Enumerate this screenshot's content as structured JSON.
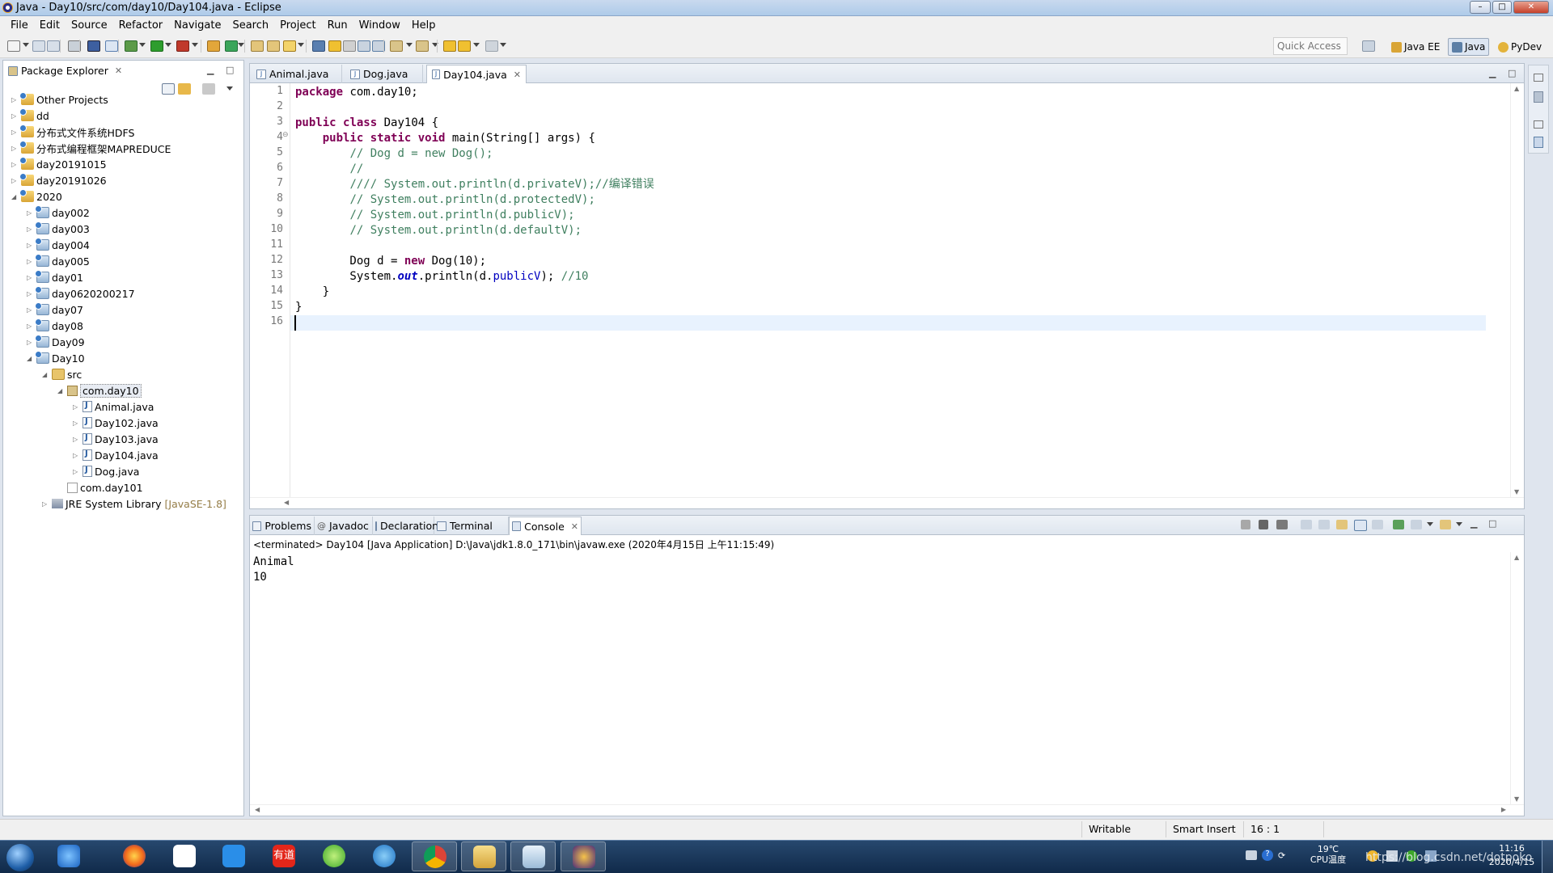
{
  "window": {
    "title": "Java - Day10/src/com/day10/Day104.java - Eclipse",
    "minimize": "–",
    "maximize": "□",
    "close": "✕"
  },
  "menu": [
    "File",
    "Edit",
    "Source",
    "Refactor",
    "Navigate",
    "Search",
    "Project",
    "Run",
    "Window",
    "Help"
  ],
  "toolbar": {
    "quick_access_placeholder": "Quick Access",
    "perspectives": [
      "Java EE",
      "Java",
      "PyDev"
    ],
    "active_perspective": "Java"
  },
  "package_explorer": {
    "title": "Package Explorer",
    "close": "✕",
    "items": [
      {
        "label": "Other Projects",
        "level": 0,
        "expanded": false,
        "icon": "working-set"
      },
      {
        "label": "dd",
        "level": 0,
        "expanded": false,
        "icon": "working-set"
      },
      {
        "label": "分布式文件系统HDFS",
        "level": 0,
        "expanded": false,
        "icon": "working-set"
      },
      {
        "label": "分布式编程框架MAPREDUCE",
        "level": 0,
        "expanded": false,
        "icon": "working-set"
      },
      {
        "label": "day20191015",
        "level": 0,
        "expanded": false,
        "icon": "working-set"
      },
      {
        "label": "day20191026",
        "level": 0,
        "expanded": false,
        "icon": "working-set"
      },
      {
        "label": "2020",
        "level": 0,
        "expanded": true,
        "icon": "working-set"
      },
      {
        "label": "day002",
        "level": 1,
        "expanded": false,
        "icon": "java-project"
      },
      {
        "label": "day003",
        "level": 1,
        "expanded": false,
        "icon": "java-project"
      },
      {
        "label": "day004",
        "level": 1,
        "expanded": false,
        "icon": "java-project"
      },
      {
        "label": "day005",
        "level": 1,
        "expanded": false,
        "icon": "java-project"
      },
      {
        "label": "day01",
        "level": 1,
        "expanded": false,
        "icon": "java-project"
      },
      {
        "label": "day0620200217",
        "level": 1,
        "expanded": false,
        "icon": "java-project"
      },
      {
        "label": "day07",
        "level": 1,
        "expanded": false,
        "icon": "java-project"
      },
      {
        "label": "day08",
        "level": 1,
        "expanded": false,
        "icon": "java-project"
      },
      {
        "label": "Day09",
        "level": 1,
        "expanded": false,
        "icon": "java-project"
      },
      {
        "label": "Day10",
        "level": 1,
        "expanded": true,
        "icon": "java-project"
      },
      {
        "label": "src",
        "level": 2,
        "expanded": true,
        "icon": "source-folder"
      },
      {
        "label": "com.day10",
        "level": 3,
        "expanded": true,
        "icon": "package",
        "selected": true
      },
      {
        "label": "Animal.java",
        "level": 4,
        "expanded": false,
        "icon": "java-file"
      },
      {
        "label": "Day102.java",
        "level": 4,
        "expanded": false,
        "icon": "java-file"
      },
      {
        "label": "Day103.java",
        "level": 4,
        "expanded": false,
        "icon": "java-file"
      },
      {
        "label": "Day104.java",
        "level": 4,
        "expanded": false,
        "icon": "java-file"
      },
      {
        "label": "Dog.java",
        "level": 4,
        "expanded": false,
        "icon": "java-file"
      },
      {
        "label": "com.day101",
        "level": 3,
        "leaf": true,
        "icon": "empty-package"
      },
      {
        "label": "JRE System Library",
        "suffix": "[JavaSE-1.8]",
        "level": 2,
        "expanded": false,
        "icon": "library"
      }
    ]
  },
  "editor": {
    "tabs": [
      {
        "label": "Animal.java",
        "active": false
      },
      {
        "label": "Dog.java",
        "active": false
      },
      {
        "label": "Day104.java",
        "active": true
      }
    ],
    "lines": [
      "package com.day10;",
      "",
      "public class Day104 {",
      "    public static void main(String[] args) {",
      "        // Dog d = new Dog();",
      "        //",
      "        //// System.out.println(d.privateV);//编译错误",
      "        // System.out.println(d.protectedV);",
      "        // System.out.println(d.publicV);",
      "        // System.out.println(d.defaultV);",
      "",
      "        Dog d = new Dog(10);",
      "        System.out.println(d.publicV); //10",
      "    }",
      "}",
      ""
    ],
    "line_numbers": [
      "1",
      "2",
      "3",
      "4",
      "5",
      "6",
      "7",
      "8",
      "9",
      "10",
      "11",
      "12",
      "13",
      "14",
      "15",
      "16"
    ],
    "fold_marker": "⊖"
  },
  "bottom_panel": {
    "tabs": [
      {
        "label": "Problems",
        "active": false
      },
      {
        "label": "Javadoc",
        "active": false,
        "prefix": "@"
      },
      {
        "label": "Declaration",
        "active": false
      },
      {
        "label": "Terminal",
        "active": false
      },
      {
        "label": "Console",
        "active": true
      }
    ],
    "status_line": "<terminated> Day104 [Java Application] D:\\Java\\jdk1.8.0_171\\bin\\javaw.exe (2020年4月15日 上午11:15:49)",
    "output": [
      "Animal",
      "10"
    ]
  },
  "status_bar": {
    "mode": "Writable",
    "insert": "Smart Insert",
    "position": "16 : 1"
  },
  "taskbar": {
    "temperature": "19℃",
    "temperature_label": "CPU温度",
    "time": "11:16",
    "date": "2020/4/15",
    "watermark": "https://blog.csdn.net/dotpoko"
  },
  "colors": {
    "keyword": "#7f0055",
    "comment": "#3f7f5f",
    "field": "#0000c0",
    "current_line": "#e8f2fe"
  }
}
